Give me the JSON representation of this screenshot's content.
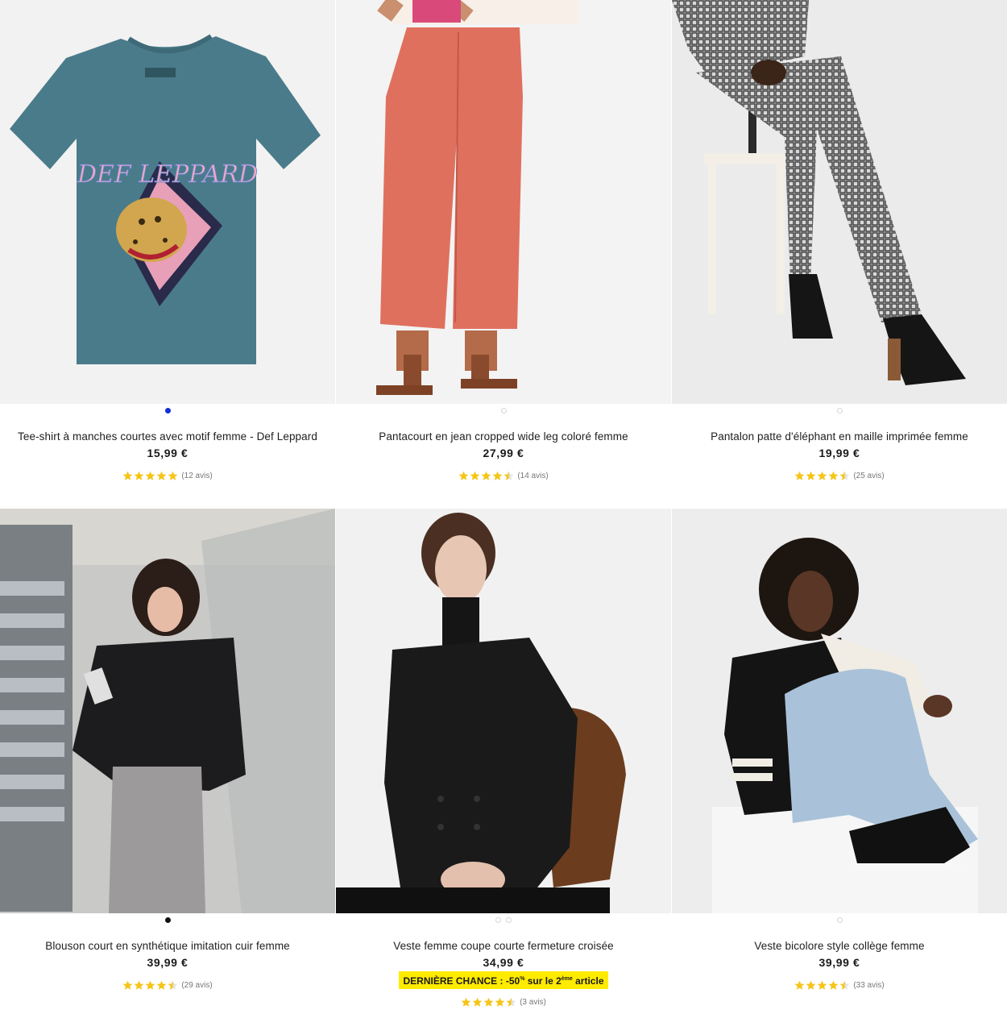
{
  "colors": {
    "star": "#f5c518",
    "dot_active_blue": "#1430d8",
    "promo_bg": "#ffeb00"
  },
  "products": [
    {
      "name": "Tee-shirt à manches courtes avec motif femme - Def Leppard",
      "price": "15,99 €",
      "rating": 5,
      "reviews": "(12 avis)",
      "image_alt": "teal tee-shirt with Def Leppard leopard print",
      "image_text": "DEF LEPPARD",
      "dots": 1,
      "active_dot": "blue"
    },
    {
      "name": "Pantacourt en jean cropped wide leg coloré femme",
      "price": "27,99 €",
      "rating": 4.5,
      "reviews": "(14 avis)",
      "image_alt": "coral wide leg cropped jeans with brown sandals",
      "dots": 1,
      "active_dot": "none"
    },
    {
      "name": "Pantalon patte d'éléphant en maille imprimée femme",
      "price": "19,99 €",
      "rating": 4.5,
      "reviews": "(25 avis)",
      "image_alt": "patterned flared knit trousers on a stool",
      "dots": 1,
      "active_dot": "none"
    },
    {
      "name": "Blouson court en synthétique imitation cuir femme",
      "price": "39,99 €",
      "rating": 4.5,
      "reviews": "(29 avis)",
      "image_alt": "black faux leather bomber jacket with grey trousers",
      "dots": 1,
      "active_dot": "black"
    },
    {
      "name": "Veste femme coupe courte fermeture croisée",
      "price": "34,99 €",
      "rating": 4.5,
      "reviews": "(3 avis)",
      "image_alt": "black cropped double-breasted jacket, seated model",
      "dots": 2,
      "active_dot": "none",
      "promo": {
        "label": "DERNIÈRE CHANCE :",
        "text_a": " -50",
        "sup_a": "%",
        "text_b": " sur le 2",
        "sup_b": "ème",
        "text_c": " article"
      }
    },
    {
      "name": "Veste bicolore style collège femme",
      "price": "39,99 €",
      "rating": 4.5,
      "reviews": "(33 avis)",
      "image_alt": "black and white varsity jacket with light jeans",
      "dots": 1,
      "active_dot": "none"
    }
  ]
}
